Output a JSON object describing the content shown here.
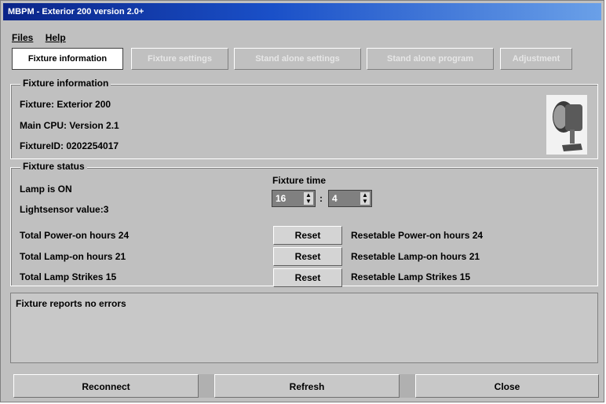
{
  "window": {
    "title": "MBPM - Exterior 200 version 2.0+"
  },
  "menu": {
    "files": "Files",
    "help": "Help"
  },
  "tabs": [
    {
      "label": "Fixture information"
    },
    {
      "label": "Fixture settings"
    },
    {
      "label": "Stand alone settings"
    },
    {
      "label": "Stand alone program"
    },
    {
      "label": "Adjustment"
    }
  ],
  "fixture_info": {
    "title": "Fixture information",
    "fixture": "Fixture: Exterior 200",
    "cpu": "Main CPU: Version 2.1",
    "fixture_id": "FixtureID: 0202254017"
  },
  "fixture_status": {
    "title": "Fixture status",
    "lamp": "Lamp is ON",
    "lightsensor": "Lightsensor value:3",
    "fixture_time_label": "Fixture time",
    "time_hours": "16",
    "time_sep": ":",
    "time_minutes": "4",
    "total_power": "Total Power-on hours 24",
    "total_lamp": "Total Lamp-on hours 21",
    "total_strikes": "Total Lamp Strikes 15",
    "reset_label": "Reset",
    "resetable_power": "Resetable Power-on hours 24",
    "resetable_lamp": "Resetable Lamp-on hours 21",
    "resetable_strikes": "Resetable Lamp Strikes 15"
  },
  "errors": {
    "message": "Fixture reports no errors"
  },
  "buttons": {
    "reconnect": "Reconnect",
    "refresh": "Refresh",
    "close": "Close"
  },
  "colors": {
    "title_start": "#0a2488",
    "title_end": "#6aa0e8",
    "face": "#c0c0c0"
  }
}
